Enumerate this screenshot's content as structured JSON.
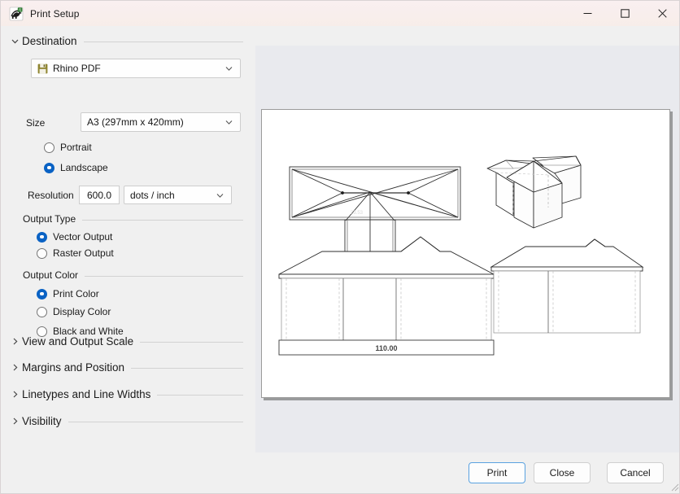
{
  "window": {
    "title": "Print Setup",
    "app_icon": "rhino-icon",
    "controls": {
      "minimize": "minimize-icon",
      "maximize": "maximize-icon",
      "close": "close-icon"
    }
  },
  "settings": {
    "destination": {
      "header": "Destination",
      "expanded": true,
      "printer": {
        "label": "",
        "value": "Rhino PDF",
        "icon": "save-disk-icon"
      },
      "size": {
        "label": "Size",
        "value": "A3 (297mm x 420mm)"
      },
      "orientation": {
        "options": [
          "Portrait",
          "Landscape"
        ],
        "selected": "Landscape"
      },
      "resolution": {
        "label": "Resolution",
        "value": "600.0",
        "unit": "dots / inch"
      },
      "output_type": {
        "header": "Output Type",
        "options": [
          "Vector Output",
          "Raster Output"
        ],
        "selected": "Vector Output"
      },
      "output_color": {
        "header": "Output Color",
        "options": [
          "Print Color",
          "Display Color",
          "Black and White"
        ],
        "selected": "Print Color"
      }
    },
    "collapsed_sections": [
      "View and Output Scale",
      "Margins and Position",
      "Linetypes and Line Widths",
      "Visibility"
    ]
  },
  "preview": {
    "paper_color": "#ffffff",
    "background_color": "#e9eaee",
    "drawings": [
      {
        "name": "roof-plan-top-view",
        "label": ""
      },
      {
        "name": "perspective-view",
        "label": ""
      },
      {
        "name": "front-elevation",
        "label": ""
      },
      {
        "name": "side-elevation",
        "label": ""
      }
    ],
    "dimension_label": "110.00"
  },
  "footer": {
    "print_label": "Print",
    "close_label": "Close",
    "cancel_label": "Cancel"
  },
  "colors": {
    "accent": "#0a62c4",
    "titlebar": "#f8eeec",
    "panel": "#f0f0f0",
    "preview_bg": "#e9eaee"
  }
}
